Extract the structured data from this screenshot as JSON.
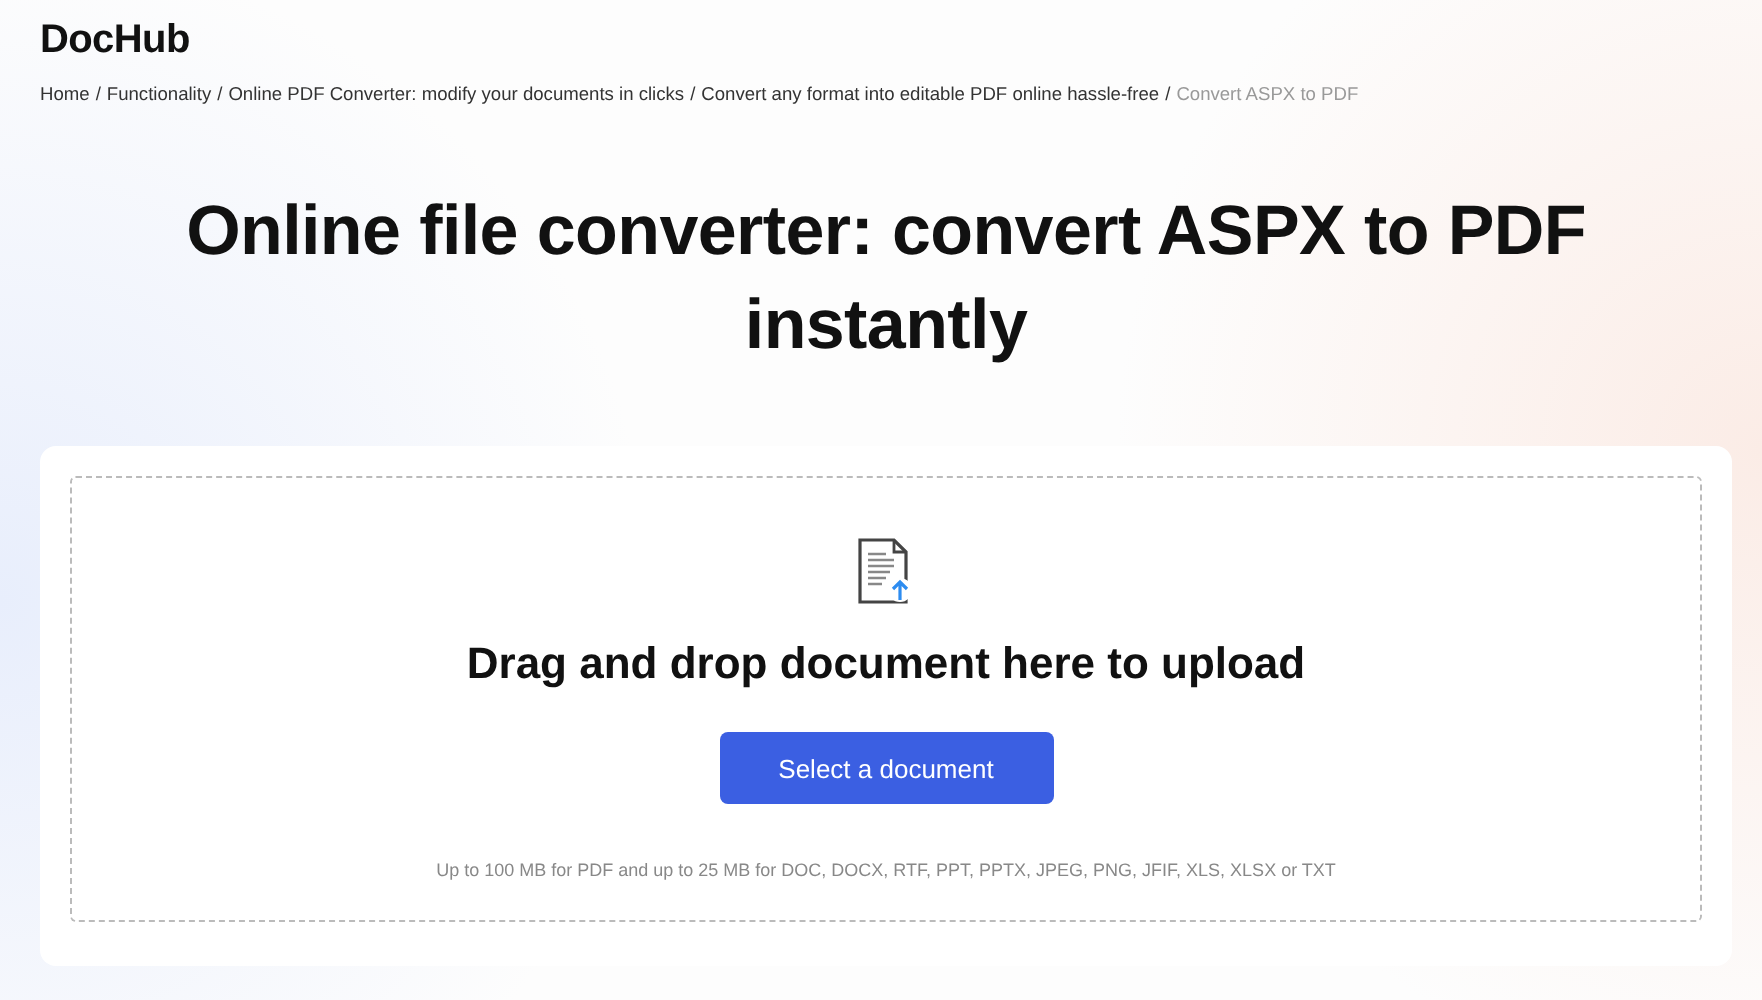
{
  "logo": "DocHub",
  "breadcrumb_separator": "/",
  "breadcrumbs": [
    {
      "label": "Home",
      "current": false
    },
    {
      "label": "Functionality",
      "current": false
    },
    {
      "label": "Online PDF Converter: modify your documents in clicks",
      "current": false
    },
    {
      "label": "Convert any format into editable PDF online hassle-free",
      "current": false
    },
    {
      "label": "Convert ASPX to PDF",
      "current": true
    }
  ],
  "title": "Online file converter: convert ASPX to PDF instantly",
  "upload": {
    "heading": "Drag and drop document here to upload",
    "button": "Select a document",
    "note": "Up to 100 MB for PDF and up to 25 MB for DOC, DOCX, RTF, PPT, PPTX, JPEG, PNG, JFIF, XLS, XLSX or TXT"
  }
}
